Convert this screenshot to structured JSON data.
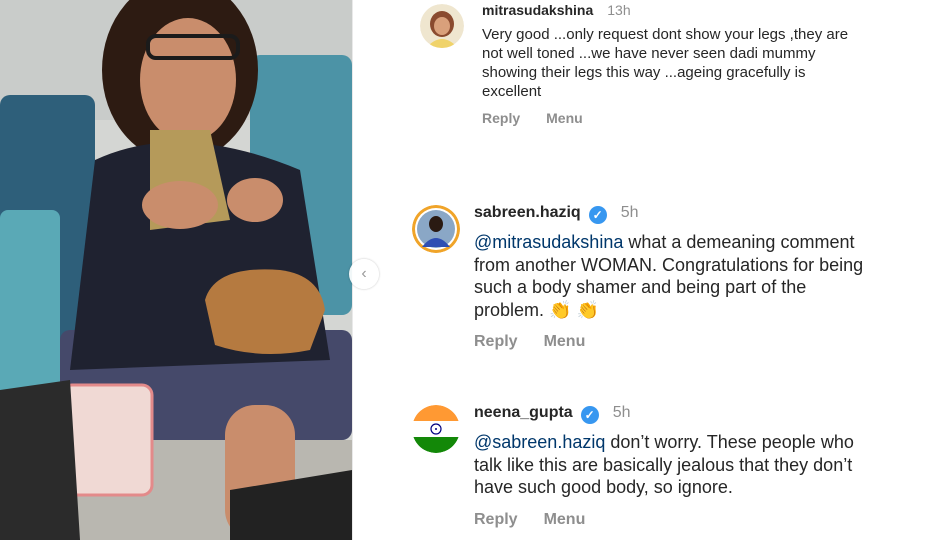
{
  "comments": [
    {
      "username": "mitrasudakshina",
      "time": "13h",
      "text": "Very good ...only request dont show your legs ,they are not well toned ...we have never seen dadi mummy showing their legs this way ...ageing gracefully  is excellent",
      "reply_label": "Reply",
      "menu_label": "Menu",
      "verified": false
    },
    {
      "username": "sabreen.haziq",
      "time": "5h",
      "mention": "@mitrasudakshina",
      "text": " what a demeaning comment from another WOMAN. Congratulations for being such a body shamer and being part of the problem. ",
      "emoji": "👏 👏",
      "reply_label": "Reply",
      "menu_label": "Menu",
      "verified": true
    },
    {
      "username": "neena_gupta",
      "time": "5h",
      "mention": "@sabreen.haziq",
      "text": " don’t worry. These people who talk like this are basically jealous that they don’t have such good body, so ignore.",
      "reply_label": "Reply",
      "menu_label": "Menu",
      "verified": true
    }
  ],
  "icons": {
    "carousel_prev": "chevron-left-icon",
    "verified": "verified-badge-icon"
  },
  "colors": {
    "username": "#262626",
    "meta": "#8e8e8e",
    "mention": "#00376b",
    "verified": "#3797f0"
  }
}
